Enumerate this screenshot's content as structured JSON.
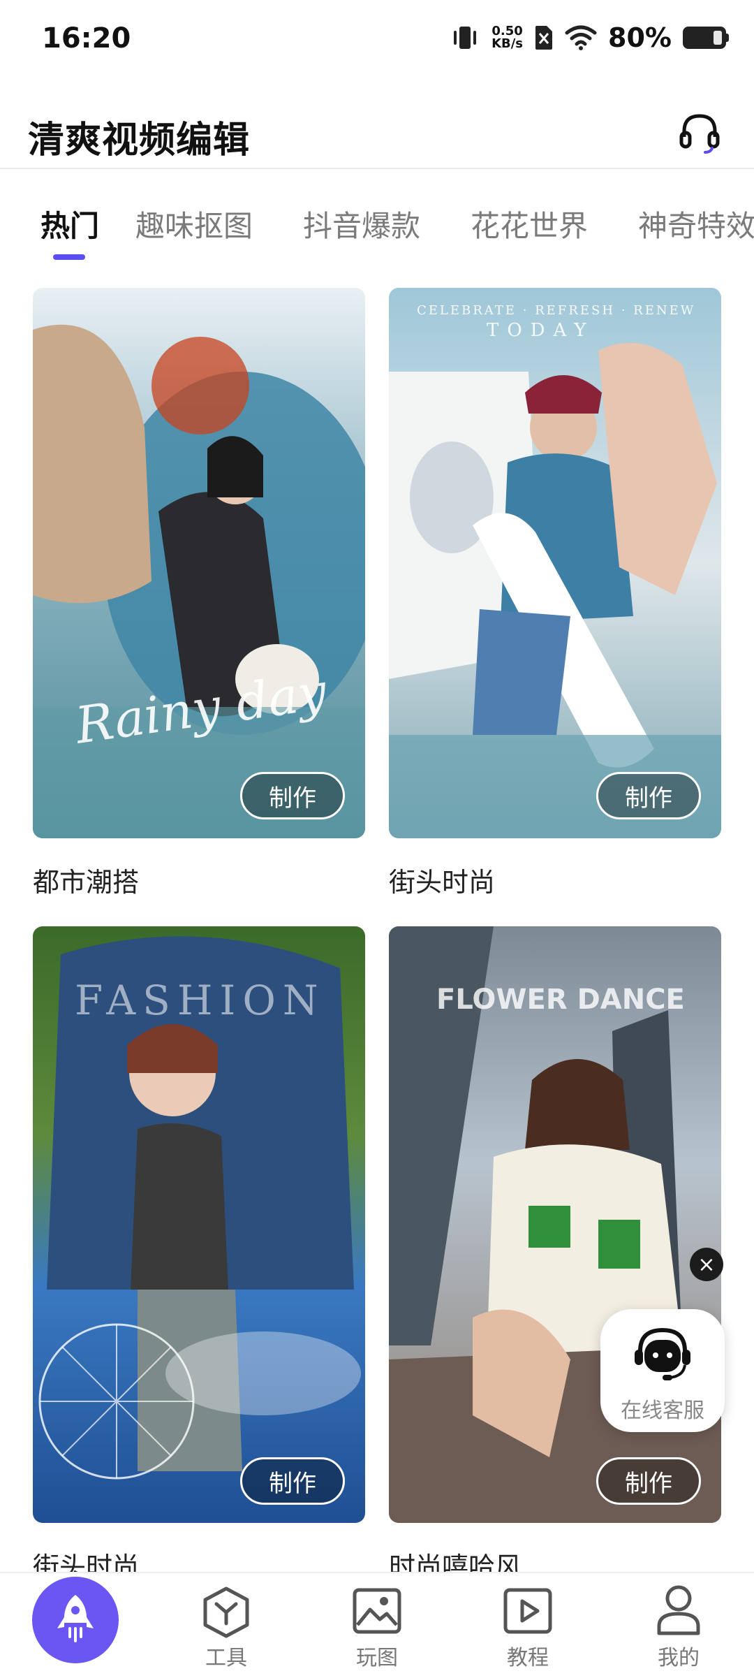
{
  "status_bar": {
    "time": "16:20",
    "net_speed_value": "0.50",
    "net_speed_unit": "KB/s",
    "battery": "80%"
  },
  "header": {
    "title": "清爽视频编辑",
    "headset_icon": "headset-icon"
  },
  "tabs": [
    {
      "label": "热门",
      "active": true
    },
    {
      "label": "趣味抠图",
      "active": false
    },
    {
      "label": "抖音爆款",
      "active": false
    },
    {
      "label": "花花世界",
      "active": false
    },
    {
      "label": "神奇特效",
      "active": false
    }
  ],
  "cards": [
    {
      "title": "都市潮搭",
      "button": "制作",
      "overlay": "Rainy day"
    },
    {
      "title": "街头时尚",
      "button": "制作",
      "overlay": "CELEBRATE · REFRESH · RENEW",
      "overlay2": "TODAY"
    },
    {
      "title": "街头时尚",
      "button": "制作",
      "overlay": "FASHION"
    },
    {
      "title": "时尚嘻哈风",
      "button": "制作",
      "overlay": "FLOWER DANCE"
    }
  ],
  "floating_service": {
    "label": "在线客服",
    "close": "×"
  },
  "bottom_nav": [
    {
      "label": "",
      "icon": "rocket-icon"
    },
    {
      "label": "工具",
      "icon": "tools-icon"
    },
    {
      "label": "玩图",
      "icon": "image-icon"
    },
    {
      "label": "教程",
      "icon": "video-play-icon"
    },
    {
      "label": "我的",
      "icon": "user-icon"
    }
  ],
  "colors": {
    "accent": "#5b4ef0",
    "fab": "#6a57f3"
  }
}
